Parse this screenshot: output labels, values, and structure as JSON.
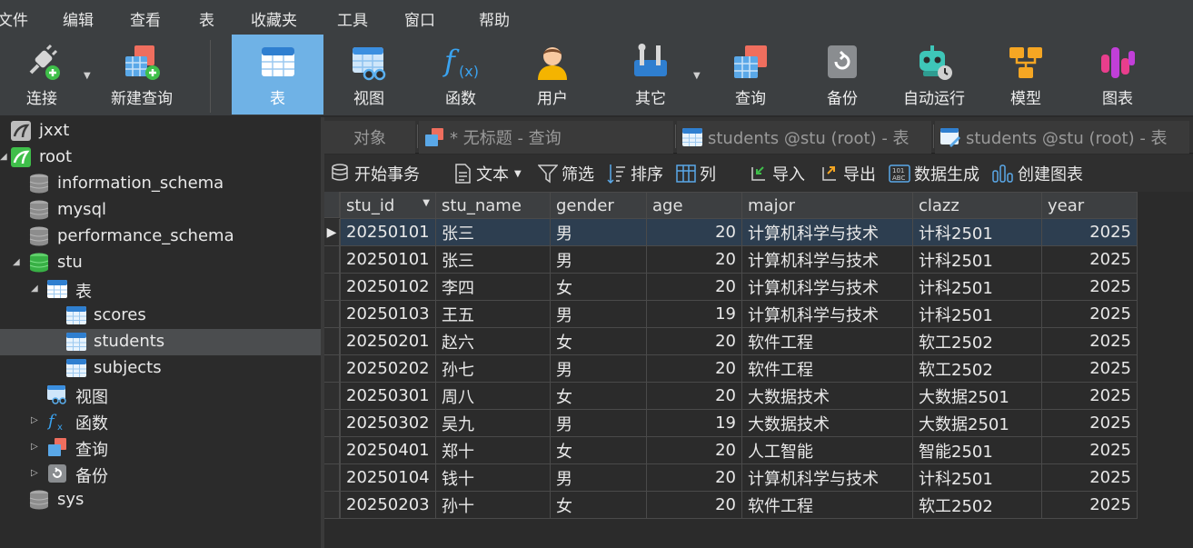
{
  "menu": [
    "文件",
    "编辑",
    "查看",
    "表",
    "收藏夹",
    "工具",
    "窗口",
    "帮助"
  ],
  "toolbar": [
    {
      "label": "连接",
      "icon": "connection-icon"
    },
    {
      "label": "新建查询",
      "icon": "new-query-icon"
    },
    {
      "label": "表",
      "icon": "table-icon",
      "active": true
    },
    {
      "label": "视图",
      "icon": "view-icon"
    },
    {
      "label": "函数",
      "icon": "function-icon"
    },
    {
      "label": "用户",
      "icon": "user-icon"
    },
    {
      "label": "其它",
      "icon": "others-icon"
    },
    {
      "label": "查询",
      "icon": "query-icon"
    },
    {
      "label": "备份",
      "icon": "backup-icon"
    },
    {
      "label": "自动运行",
      "icon": "automation-icon"
    },
    {
      "label": "模型",
      "icon": "model-icon"
    },
    {
      "label": "图表",
      "icon": "chart-icon"
    }
  ],
  "sidebar": {
    "items": [
      {
        "label": "jxxt"
      },
      {
        "label": "root"
      },
      {
        "label": "information_schema"
      },
      {
        "label": "mysql"
      },
      {
        "label": "performance_schema"
      },
      {
        "label": "stu"
      },
      {
        "label": "表"
      },
      {
        "label": "scores"
      },
      {
        "label": "students",
        "selected": true
      },
      {
        "label": "subjects"
      },
      {
        "label": "视图"
      },
      {
        "label": "函数"
      },
      {
        "label": "查询"
      },
      {
        "label": "备份"
      },
      {
        "label": "sys"
      }
    ]
  },
  "tabs": [
    {
      "label": "对象"
    },
    {
      "label": "* 无标题 - 查询"
    },
    {
      "label": "students @stu (root) - 表"
    },
    {
      "label": "students @stu (root) - 表"
    }
  ],
  "objbar": {
    "begin_tx": "开始事务",
    "text": "文本",
    "filter": "筛选",
    "sort": "排序",
    "columns": "列",
    "import": "导入",
    "export": "导出",
    "datagen": "数据生成",
    "create_chart": "创建图表"
  },
  "grid": {
    "columns": [
      "stu_id",
      "stu_name",
      "gender",
      "age",
      "major",
      "clazz",
      "year"
    ],
    "rows": [
      [
        "20250101",
        "张三",
        "男",
        "20",
        "计算机科学与技术",
        "计科2501",
        "2025"
      ],
      [
        "20250101",
        "张三",
        "男",
        "20",
        "计算机科学与技术",
        "计科2501",
        "2025"
      ],
      [
        "20250102",
        "李四",
        "女",
        "20",
        "计算机科学与技术",
        "计科2501",
        "2025"
      ],
      [
        "20250103",
        "王五",
        "男",
        "19",
        "计算机科学与技术",
        "计科2501",
        "2025"
      ],
      [
        "20250201",
        "赵六",
        "女",
        "20",
        "软件工程",
        "软工2502",
        "2025"
      ],
      [
        "20250202",
        "孙七",
        "男",
        "20",
        "软件工程",
        "软工2502",
        "2025"
      ],
      [
        "20250301",
        "周八",
        "女",
        "20",
        "大数据技术",
        "大数据2501",
        "2025"
      ],
      [
        "20250302",
        "吴九",
        "男",
        "19",
        "大数据技术",
        "大数据2501",
        "2025"
      ],
      [
        "20250401",
        "郑十",
        "女",
        "20",
        "人工智能",
        "智能2501",
        "2025"
      ],
      [
        "20250104",
        "钱十",
        "男",
        "20",
        "计算机科学与技术",
        "计科2501",
        "2025"
      ],
      [
        "20250203",
        "孙十",
        "女",
        "20",
        "软件工程",
        "软工2502",
        "2025"
      ]
    ]
  },
  "colors": {
    "active_tool": "#6fb2e6",
    "selected_row": "#2d3e50",
    "background": "#2b2b2b"
  }
}
